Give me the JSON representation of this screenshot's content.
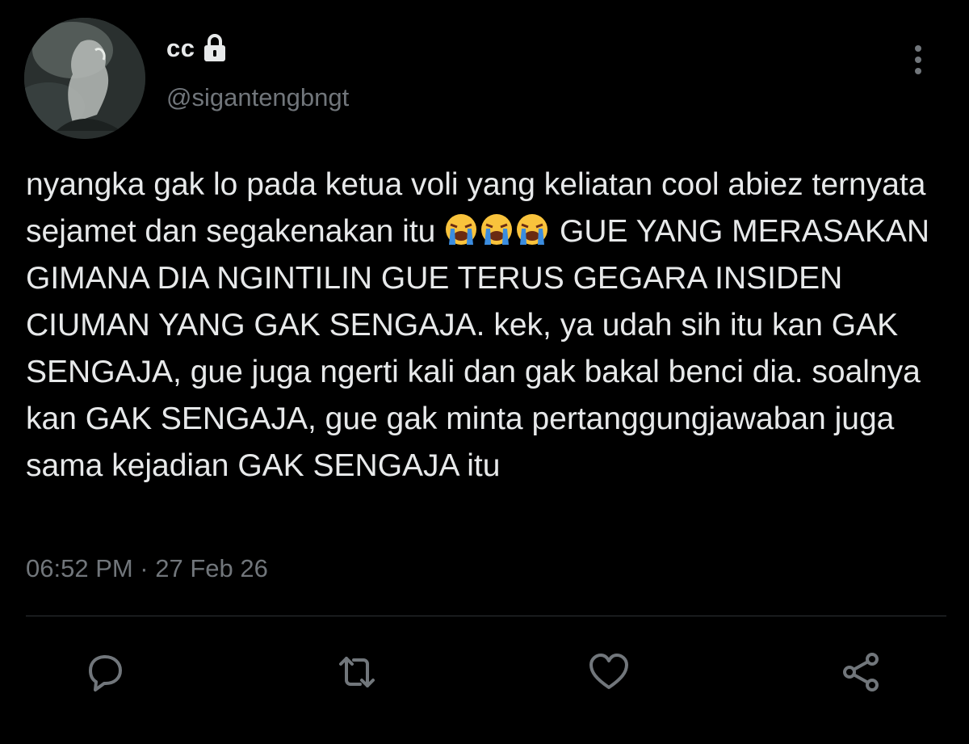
{
  "user": {
    "display_name": "cc",
    "handle": "@sigantengbngt",
    "protected": true
  },
  "tweet": {
    "text_before_emoji": "nyangka gak lo pada ketua voli yang keliatan cool abiez ternyata sejamet dan segakenakan itu ",
    "emojis": [
      "loudly-crying-face",
      "loudly-crying-face",
      "loudly-crying-face"
    ],
    "text_after_emoji": " GUE YANG MERASAKAN GIMANA DIA NGINTILIN GUE TERUS GEGARA INSIDEN CIUMAN YANG GAK SENGAJA. kek, ya udah sih itu kan GAK SENGAJA, gue juga ngerti kali dan gak bakal benci dia. soalnya kan GAK SENGAJA, gue gak minta pertanggungjawaban juga sama kejadian GAK SENGAJA itu",
    "timestamp": "06:52 PM · 27 Feb 26"
  },
  "actions": {
    "icons": [
      "reply-icon",
      "retweet-icon",
      "like-icon",
      "share-icon"
    ]
  },
  "colors": {
    "background": "#000000",
    "text_primary": "#e7e9ea",
    "text_secondary": "#71767b",
    "divider": "#2f3336"
  }
}
